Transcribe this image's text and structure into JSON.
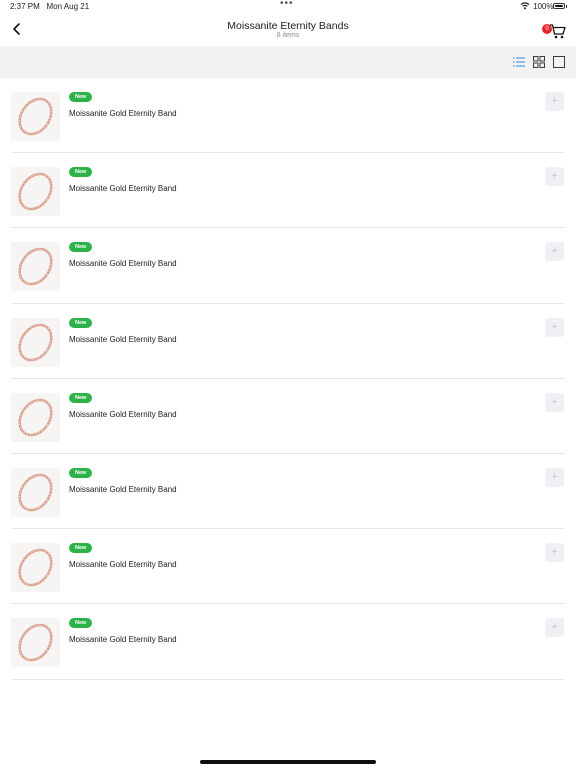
{
  "status_bar": {
    "time": "2:37 PM",
    "date": "Mon Aug 21",
    "battery": "100%"
  },
  "nav": {
    "title": "Moissanite Eternity Bands",
    "subtitle": "8 items",
    "cart_count": "0"
  },
  "toolbar": {
    "views": [
      "list-view-icon",
      "grid-view-icon",
      "single-view-icon"
    ],
    "active": "list",
    "accent": "#3d8ee0"
  },
  "products": [
    {
      "badge": "New",
      "name": "Moissanite Gold Eternity Band",
      "add_label": "+",
      "icon": "ring-icon"
    },
    {
      "badge": "New",
      "name": "Moissanite Gold Eternity Band",
      "add_label": "+",
      "icon": "ring-icon"
    },
    {
      "badge": "New",
      "name": "Moissanite Gold Eternity Band",
      "add_label": "+",
      "icon": "ring-icon"
    },
    {
      "badge": "New",
      "name": "Moissanite Gold Eternity Band",
      "add_label": "+",
      "icon": "ring-icon"
    },
    {
      "badge": "New",
      "name": "Moissanite Gold Eternity Band",
      "add_label": "+",
      "icon": "ring-icon"
    },
    {
      "badge": "New",
      "name": "Moissanite Gold Eternity Band",
      "add_label": "+",
      "icon": "ring-icon"
    },
    {
      "badge": "New",
      "name": "Moissanite Gold Eternity Band",
      "add_label": "+",
      "icon": "ring-icon"
    },
    {
      "badge": "New",
      "name": "Moissanite Gold Eternity Band",
      "add_label": "+",
      "icon": "ring-icon"
    }
  ],
  "colors": {
    "badge": "#2db24a",
    "cart_badge": "#e8262c",
    "ring": "#d89a86"
  }
}
